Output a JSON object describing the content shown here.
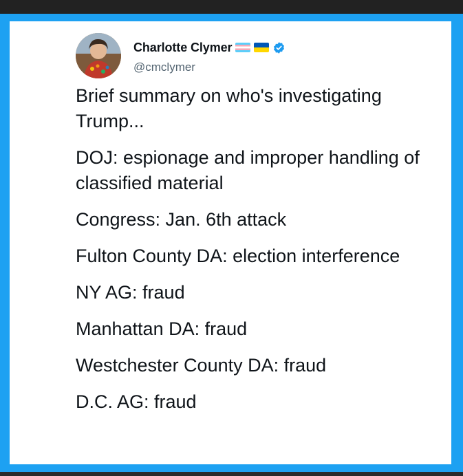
{
  "tweet": {
    "author": {
      "display_name": "Charlotte Clymer",
      "handle": "@cmclymer",
      "flags": [
        "transgender-flag-icon",
        "ukraine-flag-icon"
      ],
      "verified_icon": "verified-badge-icon"
    },
    "paragraphs": [
      "Brief summary on who's investigating Trump...",
      "DOJ: espionage and improper handling of classified material",
      "Congress: Jan. 6th attack",
      "Fulton County DA: election interference",
      "NY AG: fraud",
      "Manhattan DA: fraud",
      "Westchester County DA: fraud",
      "D.C. AG: fraud"
    ]
  },
  "colors": {
    "frame": "#1da1f2",
    "text": "#0f1419",
    "secondary_text": "#536471",
    "verified": "#1d9bf0"
  }
}
